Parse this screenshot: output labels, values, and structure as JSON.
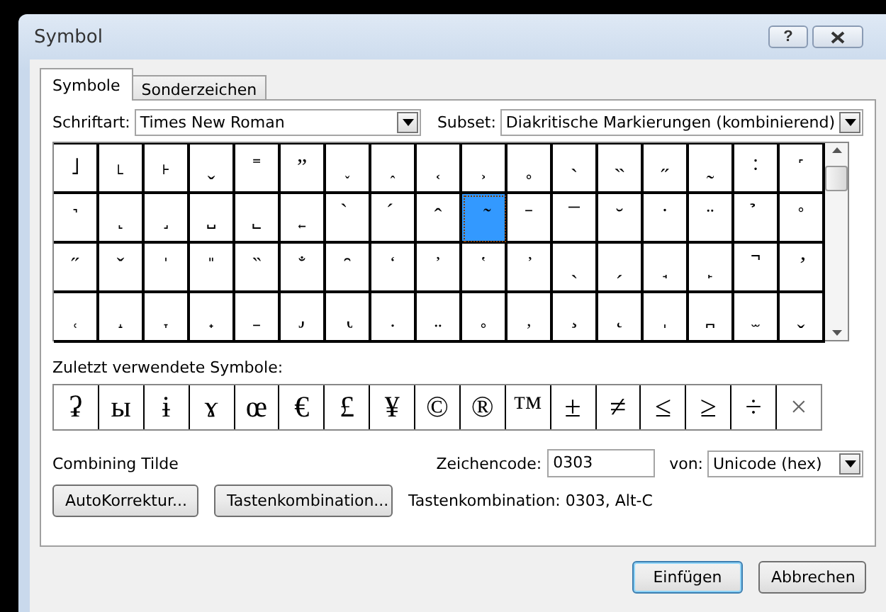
{
  "window": {
    "title": "Symbol",
    "help": "?"
  },
  "tabs": [
    {
      "label": "Symbole",
      "selected": true
    },
    {
      "label": "Sonderzeichen",
      "selected": false
    }
  ],
  "font": {
    "label": "Schriftart:",
    "value": "Times New Roman"
  },
  "subset": {
    "label": "Subset:",
    "value": "Diakritische Markierungen (kombinierend)"
  },
  "grid": {
    "rows": [
      {
        "cells": [
          {
            "char": "˩",
            "selected": false
          },
          {
            "char": "˪",
            "selected": false
          },
          {
            "char": "˫",
            "selected": false
          },
          {
            "char": "ˬ",
            "selected": false
          },
          {
            "char": "˭",
            "selected": false
          },
          {
            "char": "ˮ",
            "selected": false
          },
          {
            "char": "˯",
            "selected": false
          },
          {
            "char": "˰",
            "selected": false
          },
          {
            "char": "˱",
            "selected": false
          },
          {
            "char": "˲",
            "selected": false
          },
          {
            "char": "˳",
            "selected": false
          },
          {
            "char": "˴",
            "selected": false
          },
          {
            "char": "˵",
            "selected": false
          },
          {
            "char": "˶",
            "selected": false
          },
          {
            "char": "˷",
            "selected": false
          },
          {
            "char": "˸",
            "selected": false
          },
          {
            "char": "˹",
            "selected": false
          }
        ]
      },
      {
        "cells": [
          {
            "char": "˺",
            "selected": false
          },
          {
            "char": "˻",
            "selected": false
          },
          {
            "char": "˼",
            "selected": false
          },
          {
            "char": "˽",
            "selected": false
          },
          {
            "char": "˾",
            "selected": false
          },
          {
            "char": "˿",
            "selected": false
          },
          {
            "char": " ̀",
            "selected": false
          },
          {
            "char": " ́",
            "selected": false
          },
          {
            "char": " ̂",
            "selected": false
          },
          {
            "char": " ̃",
            "selected": true
          },
          {
            "char": " ̄",
            "selected": false
          },
          {
            "char": " ̅",
            "selected": false
          },
          {
            "char": " ̆",
            "selected": false
          },
          {
            "char": " ̇",
            "selected": false
          },
          {
            "char": " ̈",
            "selected": false
          },
          {
            "char": " ̉",
            "selected": false
          },
          {
            "char": " ̊",
            "selected": false
          }
        ]
      },
      {
        "cells": [
          {
            "char": " ̋",
            "selected": false
          },
          {
            "char": " ̌",
            "selected": false
          },
          {
            "char": " ̍",
            "selected": false
          },
          {
            "char": " ̎",
            "selected": false
          },
          {
            "char": " ̏",
            "selected": false
          },
          {
            "char": " ̐",
            "selected": false
          },
          {
            "char": " ̑",
            "selected": false
          },
          {
            "char": " ̒",
            "selected": false
          },
          {
            "char": " ̓",
            "selected": false
          },
          {
            "char": " ̔",
            "selected": false
          },
          {
            "char": " ̕",
            "selected": false
          },
          {
            "char": " ̖",
            "selected": false
          },
          {
            "char": " ̗",
            "selected": false
          },
          {
            "char": " ̘",
            "selected": false
          },
          {
            "char": " ̙",
            "selected": false
          },
          {
            "char": " ̚",
            "selected": false
          },
          {
            "char": " ̛",
            "selected": false
          }
        ]
      },
      {
        "cells": [
          {
            "char": " ̜",
            "selected": false
          },
          {
            "char": " ̝",
            "selected": false
          },
          {
            "char": " ̞",
            "selected": false
          },
          {
            "char": " ̟",
            "selected": false
          },
          {
            "char": " ̠",
            "selected": false
          },
          {
            "char": " ̡",
            "selected": false
          },
          {
            "char": " ̢",
            "selected": false
          },
          {
            "char": " ̣",
            "selected": false
          },
          {
            "char": " ̤",
            "selected": false
          },
          {
            "char": " ̥",
            "selected": false
          },
          {
            "char": " ̦",
            "selected": false
          },
          {
            "char": " ̧",
            "selected": false
          },
          {
            "char": " ̨",
            "selected": false
          },
          {
            "char": " ̩",
            "selected": false
          },
          {
            "char": " ̪",
            "selected": false
          },
          {
            "char": " ̫",
            "selected": false
          },
          {
            "char": " ̬",
            "selected": false
          }
        ]
      }
    ]
  },
  "recent": {
    "label": "Zuletzt verwendete Symbole:",
    "symbols": [
      "ʡ",
      "ы",
      "ɨ",
      "ɤ",
      "œ",
      "€",
      "£",
      "¥",
      "©",
      "®",
      "™",
      "±",
      "≠",
      "≤",
      "≥",
      "÷",
      "×"
    ]
  },
  "char_name": "Combining Tilde",
  "code": {
    "label": "Zeichencode:",
    "value": "0303"
  },
  "from": {
    "label": "von:",
    "value": "Unicode (hex)"
  },
  "autocorrect_button": "AutoKorrektur...",
  "shortcut_button": "Tastenkombination...",
  "shortcut_text": "Tastenkombination: 0303, Alt-C",
  "buttons": [
    {
      "label": "Einfügen",
      "default": true
    },
    {
      "label": "Abbrechen",
      "default": false
    }
  ]
}
